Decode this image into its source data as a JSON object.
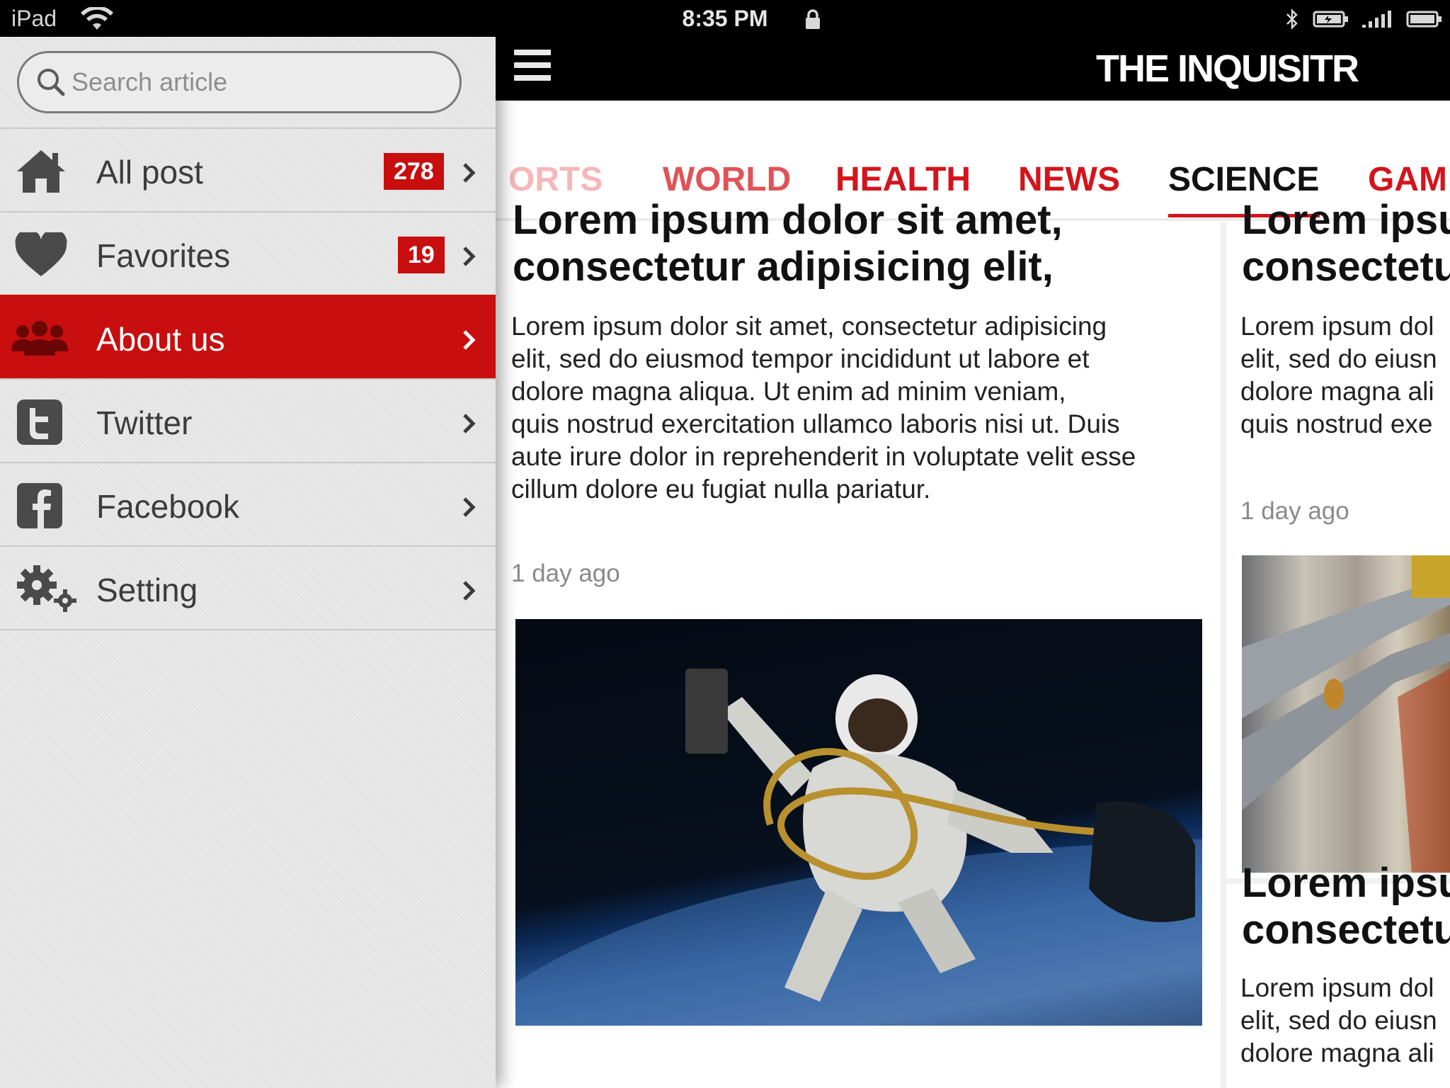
{
  "status_bar": {
    "device": "iPad",
    "time": "8:35 PM"
  },
  "sidebar": {
    "search_placeholder": "Search article",
    "items": [
      {
        "label": "All post",
        "badge": "278",
        "icon": "home-icon"
      },
      {
        "label": "Favorites",
        "badge": "19",
        "icon": "heart-icon"
      },
      {
        "label": "About us",
        "badge": "",
        "icon": "people-icon",
        "active": true
      },
      {
        "label": "Twitter",
        "badge": "",
        "icon": "twitter-icon"
      },
      {
        "label": "Facebook",
        "badge": "",
        "icon": "facebook-icon"
      },
      {
        "label": "Setting",
        "badge": "",
        "icon": "gears-icon"
      }
    ]
  },
  "header": {
    "logo_prefix": "THE IN",
    "logo_q": "Q",
    "logo_suffix": "UISITR"
  },
  "tabs": [
    {
      "label": "ORTS"
    },
    {
      "label": "WORLD"
    },
    {
      "label": "HEALTH"
    },
    {
      "label": "NEWS"
    },
    {
      "label": "SCIENCE",
      "active": true
    },
    {
      "label": "GAM"
    }
  ],
  "articles": [
    {
      "headline_line1": "Lorem ipsum dolor sit amet,",
      "headline_line2": "consectetur adipisicing elit,",
      "body": [
        "Lorem ipsum dolor sit amet, consectetur adipisicing",
        "elit, sed do eiusmod tempor incididunt ut labore et",
        "dolore magna aliqua. Ut enim ad minim veniam,",
        "quis nostrud exercitation ullamco laboris nisi ut. Duis",
        "aute irure dolor in reprehenderit in voluptate velit esse",
        "cillum dolore eu fugiat nulla pariatur."
      ],
      "time": "1 day ago"
    },
    {
      "headline_line1": "Lorem ipsu",
      "headline_line2": "consectetu",
      "body": [
        "Lorem ipsum dol",
        "elit, sed do eiusn",
        "dolore magna ali",
        "quis nostrud exe"
      ],
      "time": "1 day ago"
    },
    {
      "headline_line1": "Lorem ipsu",
      "headline_line2": "consectetu",
      "body": [
        "Lorem ipsum dol",
        "elit, sed do eiusn",
        "dolore magna ali"
      ]
    }
  ],
  "colors": {
    "accent": "#c80e0e",
    "tab_red": "#d4141c",
    "sidebar_bg": "#e6e6e6"
  }
}
